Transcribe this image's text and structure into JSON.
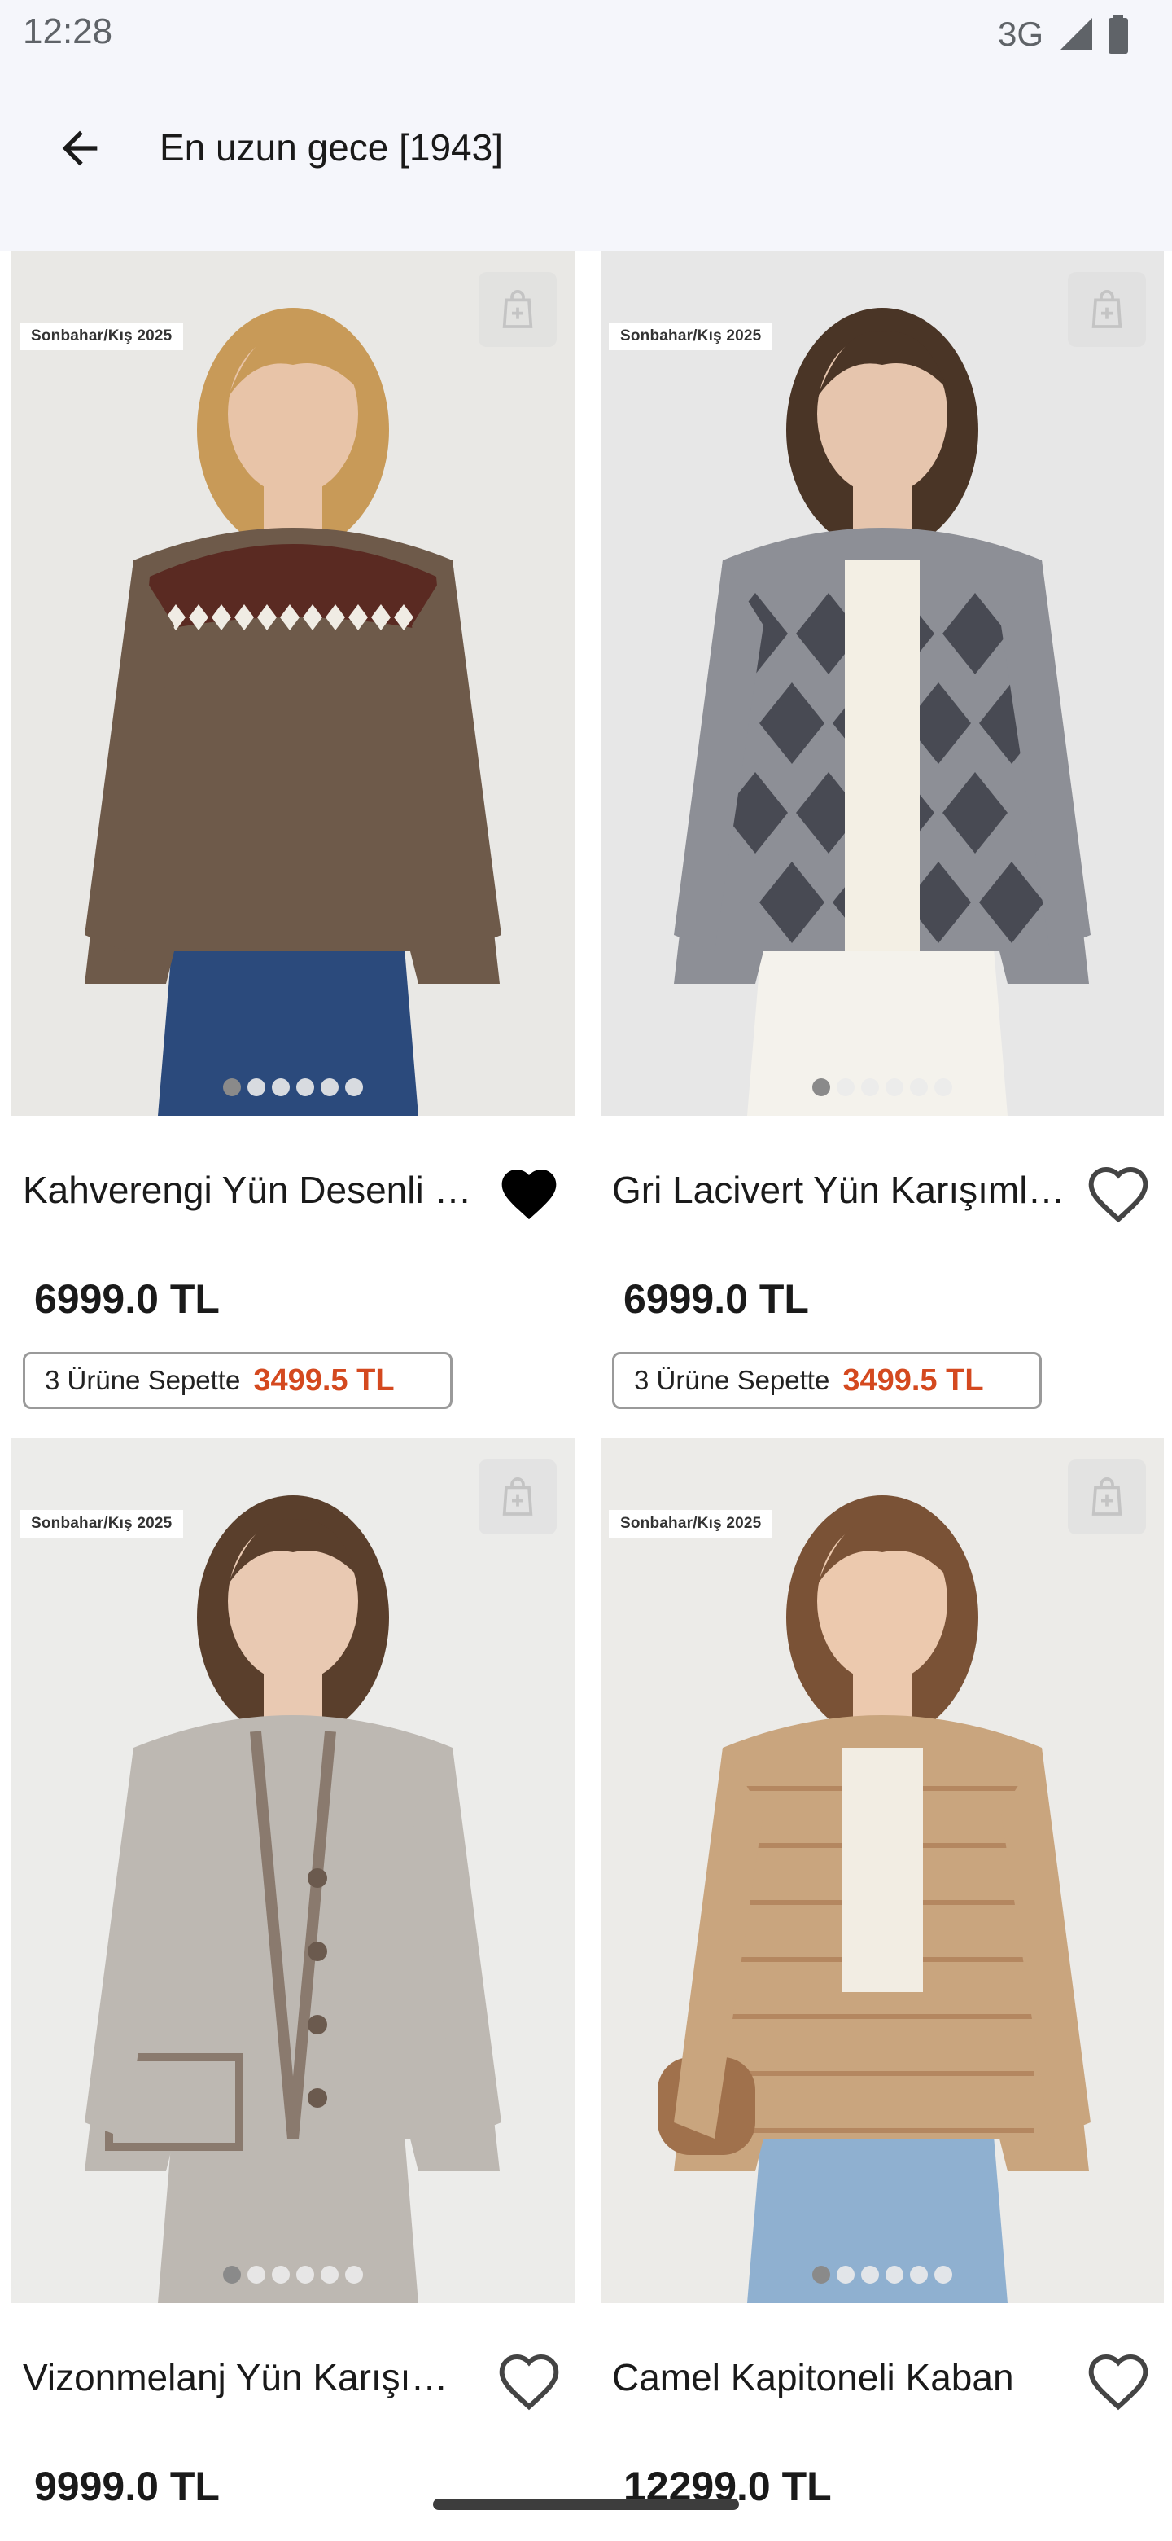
{
  "status_bar": {
    "time": "12:28",
    "network": "3G",
    "icons": [
      "signal-icon",
      "battery-icon"
    ]
  },
  "app_bar": {
    "back_icon": "arrow-left-icon",
    "title": "En uzun gece [1943]"
  },
  "products": [
    {
      "badge": "Sonbahar/Kış 2025",
      "name": "Kahverengi Yün Desenli Kazak",
      "price": "6999.0 TL",
      "promo_label": "3 Ürüne Sepette",
      "promo_price": "3499.5 TL",
      "favorited": true,
      "image_count": 6,
      "active_image": 0,
      "colors": {
        "bg": "#e9e8e5",
        "garment": "#6e5a4a",
        "accent": "#5a2a22",
        "pattern": "#f0ece4",
        "skin": "#e8c4a8",
        "hair": "#c89a58",
        "legs": "#2b4a7c"
      }
    },
    {
      "badge": "Sonbahar/Kış 2025",
      "name": "Gri Lacivert Yün Karışımlı Ceket",
      "price": "6999.0 TL",
      "promo_label": "3 Ürüne Sepette",
      "promo_price": "3499.5 TL",
      "favorited": false,
      "image_count": 6,
      "active_image": 0,
      "colors": {
        "bg": "#e7e7e7",
        "garment": "#8d8f96",
        "accent": "#3c3e48",
        "pattern": "#f3efe4",
        "skin": "#e6c5ad",
        "hair": "#4a3526",
        "legs": "#f4f2ec"
      }
    },
    {
      "badge": "Sonbahar/Kış 2025",
      "name": "Vizonmelanj Yün Karışımlı Ceket",
      "price": "9999.0 TL",
      "promo_label": "",
      "promo_price": "",
      "favorited": false,
      "image_count": 6,
      "active_image": 0,
      "colors": {
        "bg": "#ececea",
        "garment": "#bdb8b2",
        "accent": "#8a7a6e",
        "pattern": "#d8d3cc",
        "skin": "#e9c9b2",
        "hair": "#5a3f2c",
        "legs": "#bdb8b2"
      }
    },
    {
      "badge": "Sonbahar/Kış 2025",
      "name": "Camel Kapitoneli Kaban",
      "price": "12299.0 TL",
      "promo_label": "",
      "promo_price": "",
      "favorited": false,
      "image_count": 6,
      "active_image": 0,
      "colors": {
        "bg": "#ecebe8",
        "garment": "#c9a57e",
        "accent": "#b48760",
        "pattern": "#f2ede3",
        "skin": "#ecc9ae",
        "hair": "#7a5236",
        "legs": "#8fb0d0"
      }
    }
  ]
}
